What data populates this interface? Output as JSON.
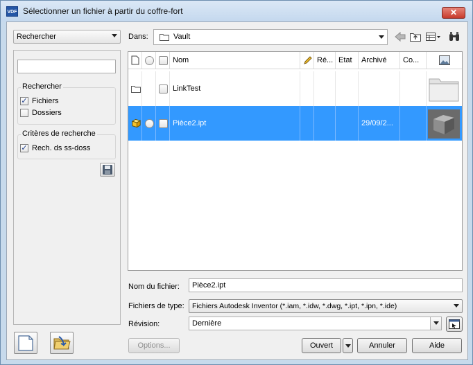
{
  "window": {
    "title": "Sélectionner un fichier à partir du coffre-fort",
    "app_icon_text": "VDF",
    "close_glyph": "✕"
  },
  "search_mode": {
    "value": "Rechercher"
  },
  "search_panel": {
    "search_value": "",
    "group1_title": "Rechercher",
    "files_label": "Fichiers",
    "files_checked": true,
    "folders_label": "Dossiers",
    "folders_checked": false,
    "group2_title": "Critères de recherche",
    "subfolders_label": "Rech. ds ss-doss",
    "subfolders_checked": true
  },
  "location": {
    "label": "Dans:",
    "value": "Vault"
  },
  "list": {
    "columns": [
      "Nom",
      "Ré...",
      "Etat",
      "Archivé",
      "Co..."
    ],
    "rows": [
      {
        "name": "LinkTest",
        "archived": "",
        "type": "folder",
        "selected": false
      },
      {
        "name": "Pièce2.ipt",
        "archived": "29/09/2...",
        "type": "part",
        "selected": true
      }
    ]
  },
  "form": {
    "filename_label": "Nom du fichier:",
    "filename_value": "Pièce2.ipt",
    "filetype_label": "Fichiers de type:",
    "filetype_value": "Fichiers Autodesk Inventor (*.iam, *.idw, *.dwg, *.ipt, *.ipn, *.ide)",
    "revision_label": "Révision:",
    "revision_value": "Dernière"
  },
  "buttons": {
    "options": "Options...",
    "open": "Ouvert",
    "cancel": "Annuler",
    "help": "Aide"
  },
  "colors": {
    "selection": "#3399ff",
    "frame": "#c7daec"
  }
}
